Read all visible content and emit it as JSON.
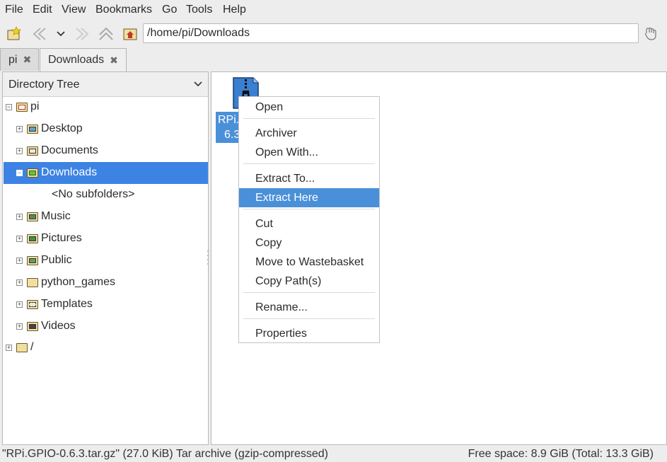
{
  "menubar": {
    "items": [
      "File",
      "Edit",
      "View",
      "Bookmarks",
      "Go",
      "Tools",
      "Help"
    ]
  },
  "toolbar": {
    "path": "/home/pi/Downloads",
    "icons": [
      "new-window-icon",
      "back-icon",
      "history-dropdown-icon",
      "forward-icon",
      "up-icon",
      "home-icon",
      "go-icon"
    ]
  },
  "tabs": [
    {
      "label": "pi",
      "close": "✖"
    },
    {
      "label": "Downloads",
      "close": "✖"
    }
  ],
  "sidebar": {
    "title": "Directory Tree",
    "tree": [
      {
        "label": "pi",
        "expander": "−",
        "icon": "home-folder-icon"
      },
      {
        "label": "Desktop",
        "expander": "+",
        "icon": "desktop-folder-icon"
      },
      {
        "label": "Documents",
        "expander": "+",
        "icon": "documents-folder-icon"
      },
      {
        "label": "Downloads",
        "expander": "−",
        "icon": "downloads-folder-icon"
      },
      {
        "label": "<No subfolders>"
      },
      {
        "label": "Music",
        "expander": "+",
        "icon": "music-folder-icon"
      },
      {
        "label": "Pictures",
        "expander": "+",
        "icon": "pictures-folder-icon"
      },
      {
        "label": "Public",
        "expander": "+",
        "icon": "public-folder-icon"
      },
      {
        "label": "python_games",
        "expander": "+",
        "icon": "folder-icon"
      },
      {
        "label": "Templates",
        "expander": "+",
        "icon": "templates-folder-icon"
      },
      {
        "label": "Videos",
        "expander": "+",
        "icon": "videos-folder-icon"
      },
      {
        "label": "/",
        "expander": "+",
        "icon": "folder-icon"
      }
    ]
  },
  "file": {
    "label_line1": "RPi.",
    "label_line2": "6.3",
    "icon": "archive-file-icon"
  },
  "context_menu": {
    "items": [
      "Open",
      "Archiver",
      "Open With...",
      "Extract To...",
      "Extract Here",
      "Cut",
      "Copy",
      "Move to Wastebasket",
      "Copy Path(s)",
      "Rename...",
      "Properties"
    ],
    "highlighted": "Extract Here"
  },
  "statusbar": {
    "left": "\"RPi.GPIO-0.6.3.tar.gz\" (27.0 KiB) Tar archive (gzip-compressed)",
    "right": "Free space: 8.9 GiB (Total: 13.3 GiB)"
  },
  "colors": {
    "selection": "#3d83e3",
    "menu_highlight": "#4a90d9",
    "window_bg": "#ededed"
  }
}
